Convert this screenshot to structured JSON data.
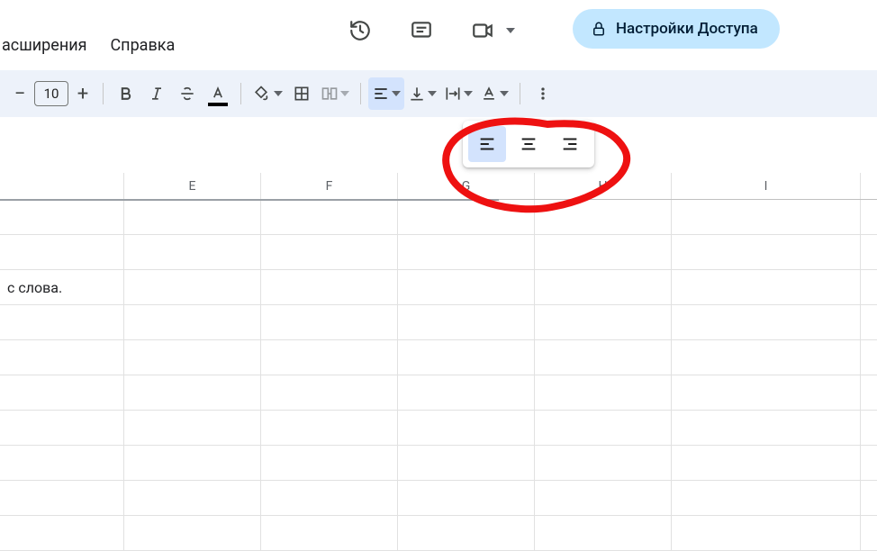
{
  "menu": {
    "extensions": "асширения",
    "help": "Справка"
  },
  "share": {
    "label": "Настройки Доступа"
  },
  "toolbar": {
    "font_size": "10"
  },
  "columns": [
    "E",
    "F",
    "G",
    "H",
    "I"
  ],
  "cells": {
    "r2c0": "с слова."
  },
  "icons": {
    "history": "history-icon",
    "comments": "comments-icon",
    "meet": "meet-icon",
    "lock": "lock-icon",
    "bold": "bold-icon",
    "italic": "italic-icon",
    "strike": "strikethrough-icon",
    "text_color": "text-color-icon",
    "fill_color": "fill-color-icon",
    "borders": "borders-icon",
    "merge": "merge-cells-icon",
    "halign": "horizontal-align-icon",
    "valign": "vertical-align-icon",
    "wrap": "text-wrap-icon",
    "rotate": "text-rotation-icon",
    "more": "more-icon",
    "align_left": "align-left-icon",
    "align_center": "align-center-icon",
    "align_right": "align-right-icon"
  }
}
